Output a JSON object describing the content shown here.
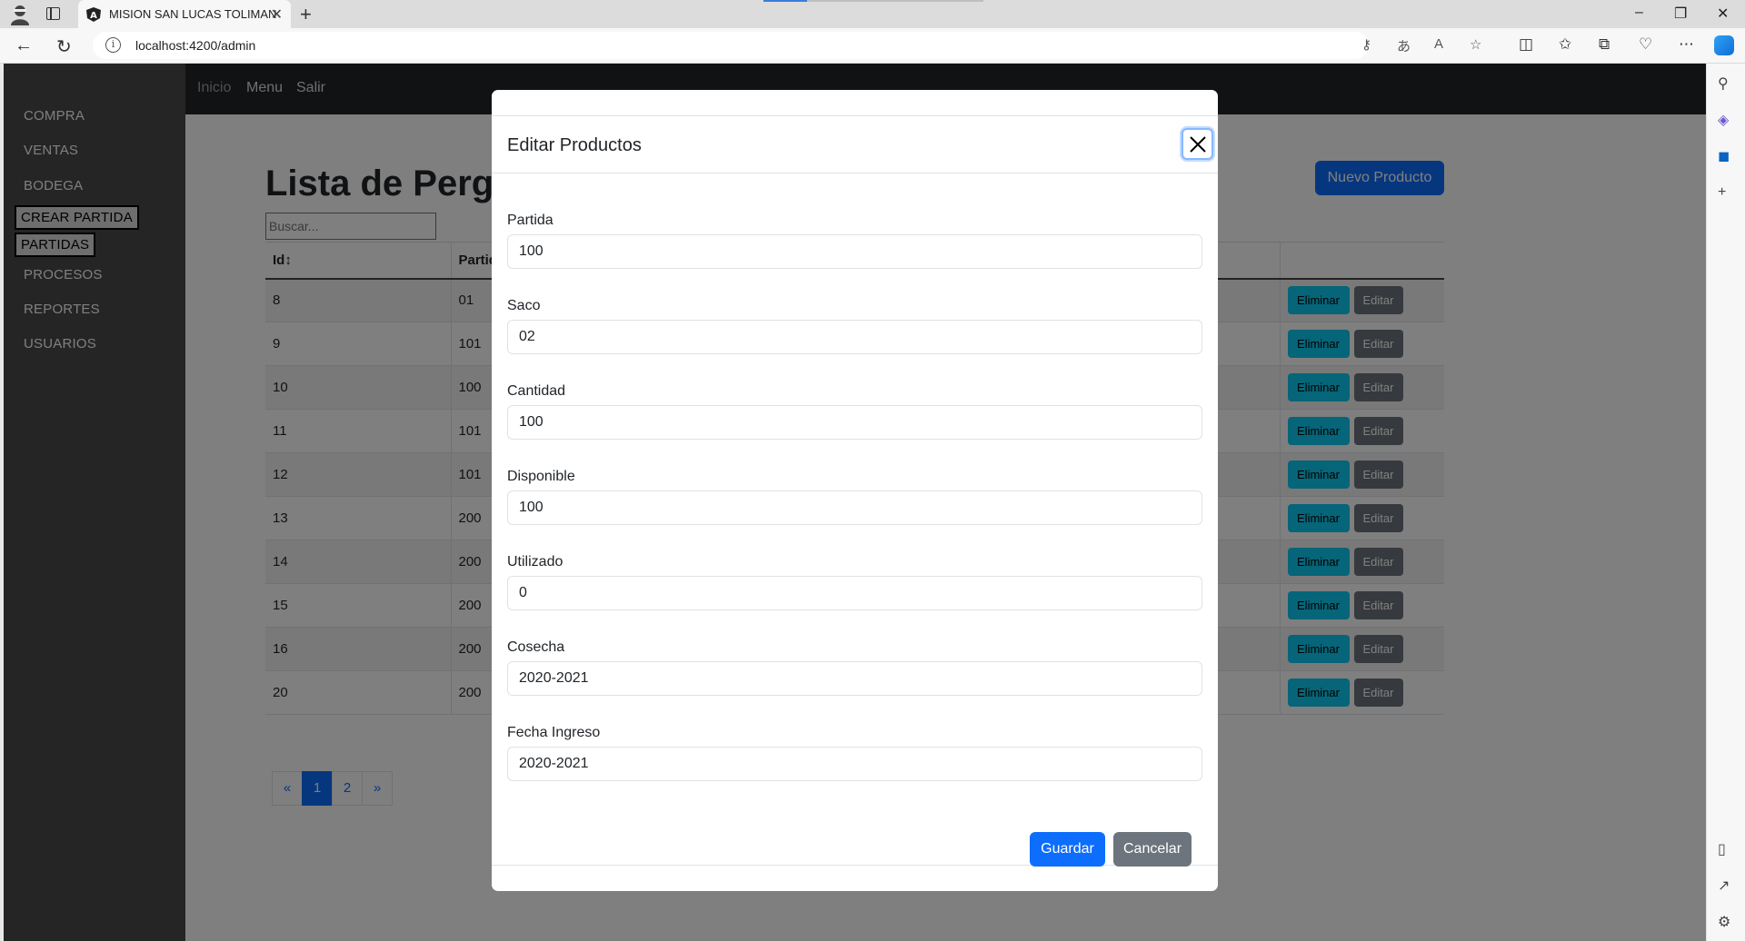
{
  "browser": {
    "tab_title": "MISION SAN LUCAS TOLIMAN",
    "url": "localhost:4200/admin",
    "new_tab": "+",
    "tab_close": "✕"
  },
  "sidebar": {
    "items": [
      {
        "label": "COMPRA"
      },
      {
        "label": "VENTAS"
      },
      {
        "label": "BODEGA"
      },
      {
        "label": "CREAR PARTIDA"
      },
      {
        "label": "PARTIDAS"
      },
      {
        "label": "PROCESOS"
      },
      {
        "label": "REPORTES"
      },
      {
        "label": "USUARIOS"
      }
    ]
  },
  "topnav": {
    "home": "Inicio",
    "menu": "Menu",
    "logout": "Salir"
  },
  "main": {
    "title": "Lista de Pergamino",
    "search_placeholder": "Buscar...",
    "new_button": "Nuevo Producto",
    "columns": [
      "Id↕",
      "Partida",
      ""
    ],
    "rows": [
      {
        "id": "8",
        "partida": "01"
      },
      {
        "id": "9",
        "partida": "101"
      },
      {
        "id": "10",
        "partida": "100"
      },
      {
        "id": "11",
        "partida": "101"
      },
      {
        "id": "12",
        "partida": "101"
      },
      {
        "id": "13",
        "partida": "200"
      },
      {
        "id": "14",
        "partida": "200"
      },
      {
        "id": "15",
        "partida": "200"
      },
      {
        "id": "16",
        "partida": "200"
      },
      {
        "id": "20",
        "partida": "200"
      }
    ],
    "delete_label": "Eliminar",
    "edit_label": "Editar",
    "pager": {
      "prev": "«",
      "pages": [
        "1",
        "2"
      ],
      "next": "»",
      "current": "1"
    }
  },
  "modal": {
    "title": "Editar Productos",
    "fields": [
      {
        "label": "Partida",
        "value": "100"
      },
      {
        "label": "Saco",
        "value": "02"
      },
      {
        "label": "Cantidad",
        "value": "100"
      },
      {
        "label": "Disponible",
        "value": "100"
      },
      {
        "label": "Utilizado",
        "value": "0"
      },
      {
        "label": "Cosecha",
        "value": "2020-2021"
      },
      {
        "label": "Fecha Ingreso",
        "value": "2020-2021"
      }
    ],
    "save_label": "Guardar",
    "cancel_label": "Cancelar"
  },
  "colors": {
    "primary": "#0d6efd",
    "info": "#0dcaf0",
    "secondary": "#6c757d",
    "navbar": "#212529",
    "sidebar": "#4a4a4a"
  }
}
